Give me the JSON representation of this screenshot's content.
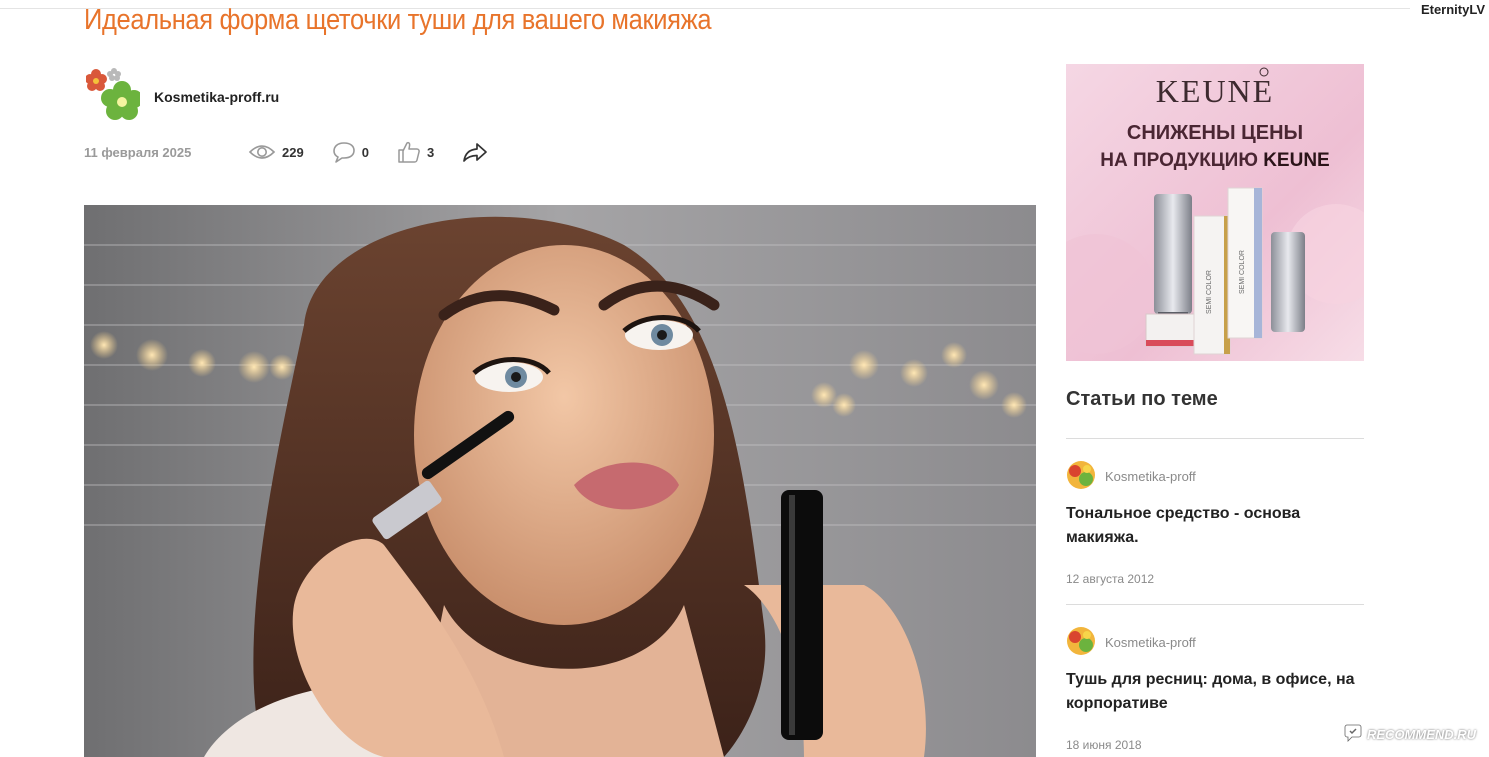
{
  "corner_user": "EternityLV",
  "article": {
    "title": "Идеальная форма щеточки туши для вашего макияжа",
    "author": "Kosmetika-proff.ru",
    "date": "11 февраля 2025",
    "views": "229",
    "comments": "0",
    "likes": "3"
  },
  "ad": {
    "brand": "KEUNE",
    "line1": "СНИЖЕНЫ ЦЕНЫ",
    "line2_prefix": "НА ПРОДУКЦИЮ ",
    "line2_brand": "KEUNE",
    "product_label": "SEMI COLOR"
  },
  "sidebar": {
    "heading": "Статьи по теме",
    "items": [
      {
        "author": "Kosmetika-proff",
        "title": "Тональное средство - основа макияжа.",
        "date": "12 августа 2012"
      },
      {
        "author": "Kosmetika-proff",
        "title": "Тушь для ресниц: дома, в офисе, на корпоративе",
        "date": "18 июня 2018"
      }
    ]
  },
  "watermark": "RECOMMEND.RU",
  "colors": {
    "title": "#e8742b",
    "muted": "#9a9a9a",
    "ad_pink": "#f2c6d8",
    "ad_text": "#4a2633"
  },
  "icons": [
    "flower-logo-icon",
    "eye-icon",
    "comment-icon",
    "thumbs-up-icon",
    "share-icon",
    "recommend-logo-icon"
  ]
}
